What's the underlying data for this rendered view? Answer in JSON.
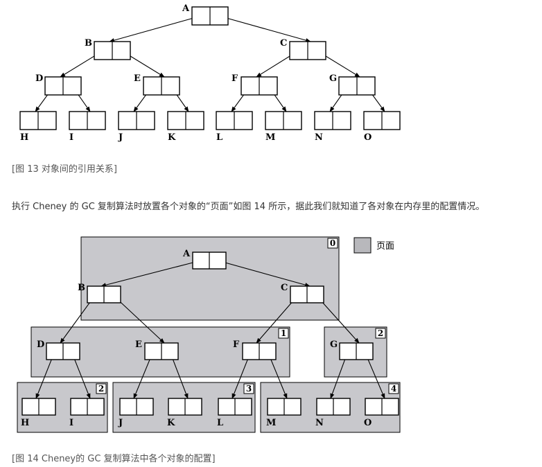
{
  "figure13": {
    "caption": "[图 13    对象间的引用关系]",
    "nodes": [
      "A",
      "B",
      "C",
      "D",
      "E",
      "F",
      "G",
      "H",
      "I",
      "J",
      "K",
      "L",
      "M",
      "N",
      "O"
    ]
  },
  "paragraph": "执行 Cheney 的 GC 复制算法时放置各个对象的“页面”如图 14 所示，据此我们就知道了各对象在内存里的配置情况。",
  "figure14": {
    "caption": "[图 14    Cheney的 GC 复制算法中各个对象的配置]",
    "legend_label": "页面",
    "colors": {
      "page_fill": "#c8c8cc",
      "legend_fill": "#b8b8bc",
      "stroke": "#000000"
    },
    "pages": [
      {
        "number": "0",
        "objects": [
          "A",
          "B",
          "C"
        ]
      },
      {
        "number": "1",
        "objects": [
          "D",
          "E",
          "F"
        ]
      },
      {
        "number": "2",
        "objects": [
          "G"
        ]
      },
      {
        "number": "2",
        "objects": [
          "H",
          "I"
        ]
      },
      {
        "number": "3",
        "objects": [
          "J",
          "K",
          "L"
        ]
      },
      {
        "number": "4",
        "objects": [
          "M",
          "N",
          "O"
        ]
      }
    ]
  }
}
